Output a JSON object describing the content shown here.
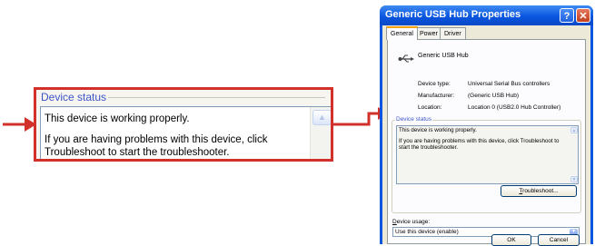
{
  "zoom": {
    "legend": "Device status",
    "status_line_1": "This device is working properly.",
    "status_line_2": "If you are having problems with this device, click Troubleshoot to start the troubleshooter."
  },
  "dialog": {
    "title": "Generic USB Hub Properties",
    "help_glyph": "?",
    "close_glyph": "✕",
    "tabs": [
      {
        "label": "General"
      },
      {
        "label": "Power"
      },
      {
        "label": "Driver"
      }
    ],
    "device_name": "Generic USB Hub",
    "properties": {
      "device_type_label": "Device type:",
      "device_type_value": "Universal Serial Bus controllers",
      "manufacturer_label": "Manufacturer:",
      "manufacturer_value": "(Generic USB Hub)",
      "location_label": "Location:",
      "location_value": "Location 0 (USB2.0 Hub Controller)"
    },
    "device_status": {
      "legend": "Device status",
      "line_1": "This device is working properly.",
      "line_2": "If you are having problems with this device, click Troubleshoot to start the troubleshooter."
    },
    "troubleshoot_button": {
      "mnemonic": "T",
      "rest": "roubleshoot..."
    },
    "device_usage": {
      "label_mnemonic": "D",
      "label_rest": "evice usage:",
      "selected": "Use this device (enable)"
    },
    "ok_label": "OK",
    "cancel_label": "Cancel"
  },
  "colors": {
    "callout_border": "#d2302a",
    "arrow": "#d2302a",
    "title_bar": "#0a56e0",
    "group_legend": "#3c55c9"
  }
}
